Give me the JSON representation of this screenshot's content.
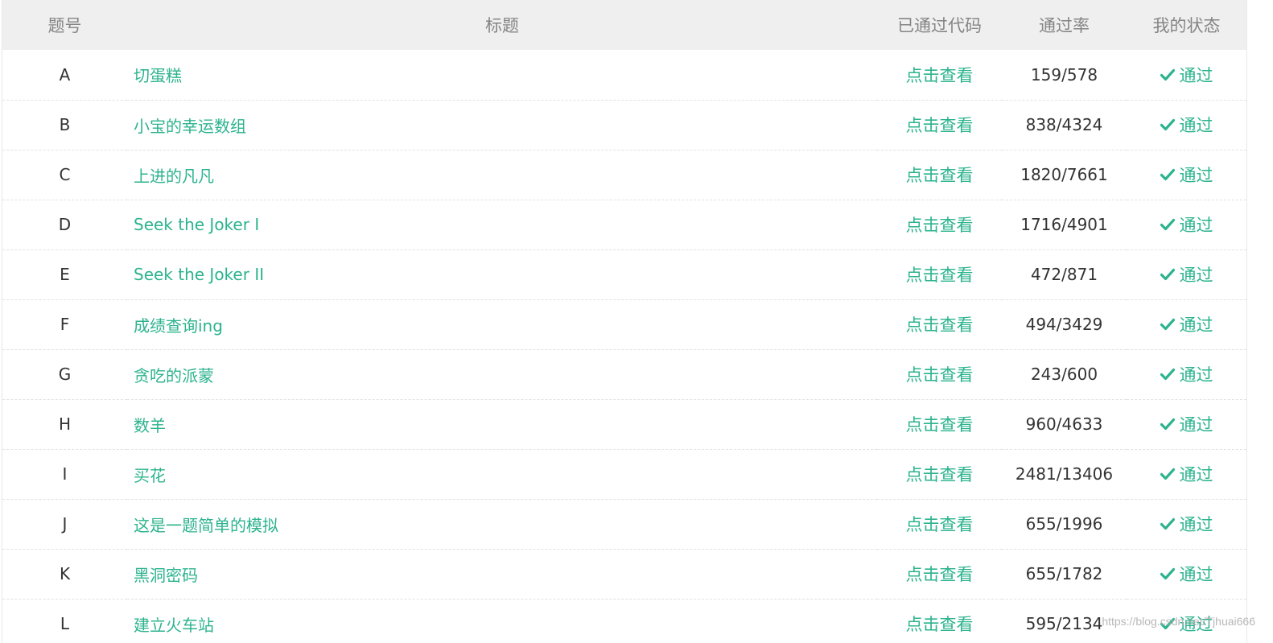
{
  "header": {
    "id": "题号",
    "title": "标题",
    "code": "已通过代码",
    "rate": "通过率",
    "status": "我的状态"
  },
  "rows": [
    {
      "id": "A",
      "title": "切蛋糕",
      "code": "点击查看",
      "rate": "159/578",
      "status": "通过"
    },
    {
      "id": "B",
      "title": "小宝的幸运数组",
      "code": "点击查看",
      "rate": "838/4324",
      "status": "通过"
    },
    {
      "id": "C",
      "title": "上进的凡凡",
      "code": "点击查看",
      "rate": "1820/7661",
      "status": "通过"
    },
    {
      "id": "D",
      "title": "Seek the Joker I",
      "code": "点击查看",
      "rate": "1716/4901",
      "status": "通过"
    },
    {
      "id": "E",
      "title": "Seek the Joker II",
      "code": "点击查看",
      "rate": "472/871",
      "status": "通过"
    },
    {
      "id": "F",
      "title": "成绩查询ing",
      "code": "点击查看",
      "rate": "494/3429",
      "status": "通过"
    },
    {
      "id": "G",
      "title": "贪吃的派蒙",
      "code": "点击查看",
      "rate": "243/600",
      "status": "通过"
    },
    {
      "id": "H",
      "title": "数羊",
      "code": "点击查看",
      "rate": "960/4633",
      "status": "通过"
    },
    {
      "id": "I",
      "title": "买花",
      "code": "点击查看",
      "rate": "2481/13406",
      "status": "通过"
    },
    {
      "id": "J",
      "title": "这是一题简单的模拟",
      "code": "点击查看",
      "rate": "655/1996",
      "status": "通过"
    },
    {
      "id": "K",
      "title": "黑洞密码",
      "code": "点击查看",
      "rate": "655/1782",
      "status": "通过"
    },
    {
      "id": "L",
      "title": "建立火车站",
      "code": "点击查看",
      "rate": "595/2134",
      "status": "通过"
    }
  ],
  "icons": {
    "status": "check-icon"
  },
  "colors": {
    "accent": "#2cb38e",
    "header_bg": "#efefef",
    "header_text": "#858585",
    "cell_text": "#333333"
  },
  "watermark": "https://blog.csdn.net/Tjhuai666"
}
